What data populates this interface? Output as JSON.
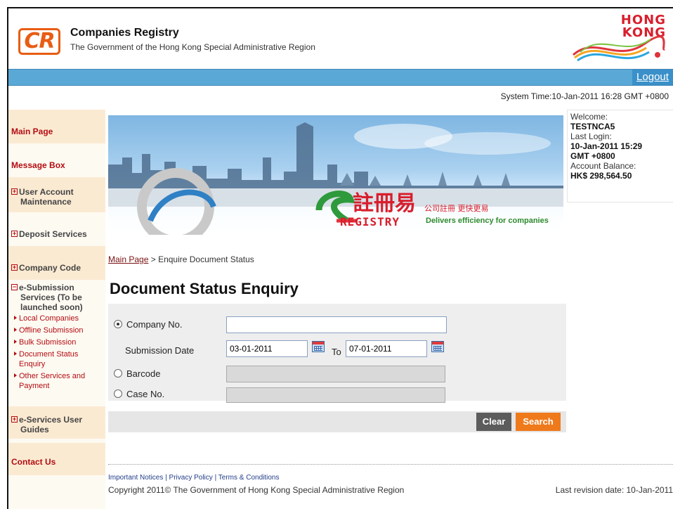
{
  "header": {
    "logo_text": "CR",
    "title": "Companies Registry",
    "subtitle": "The Government of the Hong Kong Special Administrative Region",
    "brand_logo_text": [
      "HONG",
      "KONG"
    ]
  },
  "topbar": {
    "logout": "Logout"
  },
  "system_time": "System Time:10-Jan-2011 16:28 GMT +0800",
  "sidebar": {
    "main_page": "Main Page",
    "message_box": "Message Box",
    "user_account": [
      "User Account",
      "Maintenance"
    ],
    "deposit_services": "Deposit Services",
    "company_code": "Company Code",
    "esubmission": [
      "e-Submission",
      "Services (To be",
      "launched soon)"
    ],
    "sub_items": [
      "Local Companies",
      "Offline Submission",
      "Bulk Submission",
      "Document Status",
      "Enquiry",
      "Other Services and",
      "Payment"
    ],
    "user_guides": [
      "e-Services User",
      "Guides"
    ],
    "contact_us": "Contact Us"
  },
  "banner": {
    "chinese_title": "註冊易",
    "registry": "REGISTRY",
    "tagline_cn": "公司註冊 更快更易",
    "tagline_en": "Delivers efficiency for companies"
  },
  "welcome": {
    "label": "Welcome:",
    "user": "TESTNCA5",
    "last_login_label": "Last Login:",
    "last_login_date": "10-Jan-2011 15:29",
    "last_login_tz": "GMT +0800",
    "balance_label": "Account Balance:",
    "balance": "HK$ 298,564.50"
  },
  "breadcrumb": {
    "home": "Main Page",
    "sep": " > ",
    "current": "Enquire Document Status"
  },
  "page_title": "Document Status Enquiry",
  "form": {
    "company_no_label": "Company No.",
    "company_no_value": "",
    "submission_date_label": "Submission Date",
    "date_from": "03-01-2011",
    "to_label": "To",
    "date_to": "07-01-2011",
    "barcode_label": "Barcode",
    "case_no_label": "Case No.",
    "clear": "Clear",
    "search": "Search"
  },
  "footer": {
    "links": [
      "Important Notices",
      "Privacy Policy",
      "Terms & Conditions"
    ],
    "copyright": "Copyright 2011© The Government of Hong Kong Special Administrative Region",
    "revision": "Last revision date: 10-Jan-2011"
  },
  "colors": {
    "accent_orange": "#ef7a1c",
    "bar_blue": "#5aa8d6",
    "nav_red": "#b30d12"
  }
}
